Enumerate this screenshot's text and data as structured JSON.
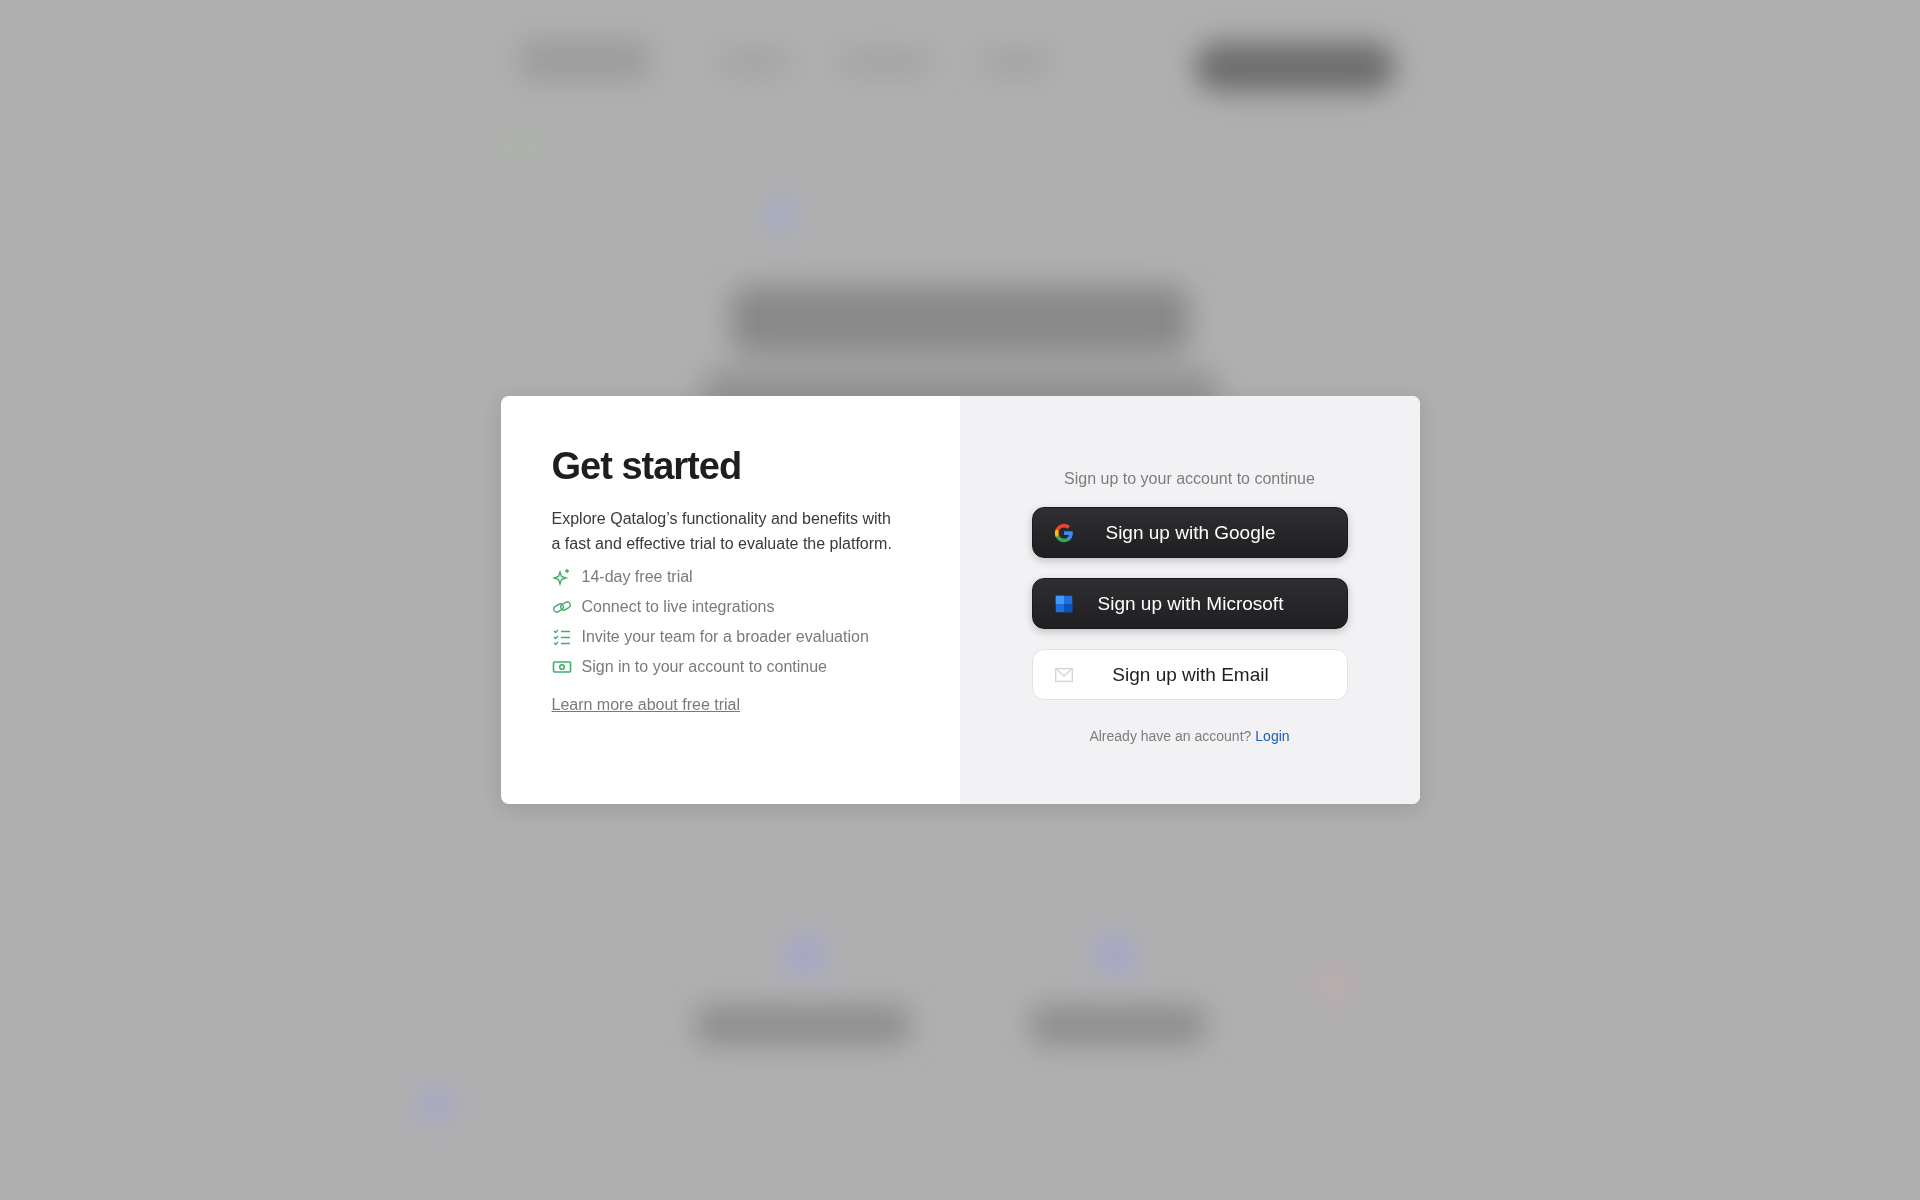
{
  "intro": {
    "title": "Get started",
    "description": "Explore Qatalog’s functionality and benefits with a fast and effective trial to evaluate the platform."
  },
  "features": [
    {
      "label": "14-day free trial"
    },
    {
      "label": "Connect to live integrations"
    },
    {
      "label": "Invite your team for a broader evaluation"
    },
    {
      "label": "Sign in to your account to continue"
    }
  ],
  "learn_more_link": "Learn more about free trial",
  "signup": {
    "subtitle": "Sign up to your account to continue",
    "buttons": [
      {
        "kind": "google",
        "label": "Sign up with Google"
      },
      {
        "kind": "microsoft",
        "label": "Sign up with Microsoft"
      },
      {
        "kind": "email",
        "label": "Sign up with Email"
      }
    ],
    "login_prompt": "Already have an account?",
    "login_link": "Login"
  }
}
